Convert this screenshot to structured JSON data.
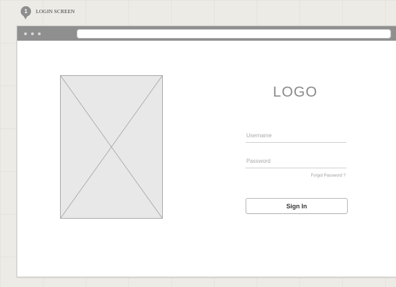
{
  "screen_tag": {
    "number": "1",
    "label": "LOGIN SCREEN"
  },
  "browser": {
    "address_value": ""
  },
  "login": {
    "logo_text": "LOGO",
    "username_placeholder": "Username",
    "password_placeholder": "Password",
    "forgot_password": "Forgot Password ?",
    "signin_label": "Sign In"
  },
  "colors": {
    "titlebar": "#8f8f8f",
    "image_placeholder": "#e8e8e8",
    "background": "#ecebe6"
  },
  "icons": {
    "image_placeholder": "image-placeholder-icon",
    "window_controls": "window-dots-icon"
  }
}
